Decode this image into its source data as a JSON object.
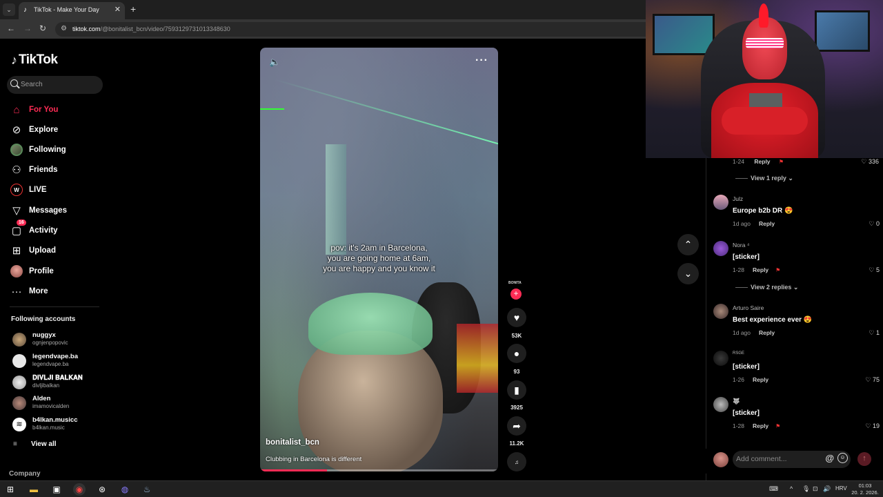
{
  "browser": {
    "tab_title": "TikTok - Make Your Day",
    "url_host": "tiktok.com",
    "url_path": "/@bonitalist_bcn/video/7593129731013348630"
  },
  "sidebar": {
    "logo": "TikTok",
    "search_placeholder": "Search",
    "nav": [
      {
        "label": "For You",
        "icon": "home-icon"
      },
      {
        "label": "Explore",
        "icon": "compass-icon"
      },
      {
        "label": "Following",
        "icon": "following-avatar-icon"
      },
      {
        "label": "Friends",
        "icon": "friends-icon"
      },
      {
        "label": "LIVE",
        "icon": "live-icon"
      },
      {
        "label": "Messages",
        "icon": "messages-icon"
      },
      {
        "label": "Activity",
        "icon": "activity-icon",
        "badge": "16"
      },
      {
        "label": "Upload",
        "icon": "upload-icon"
      },
      {
        "label": "Profile",
        "icon": "profile-icon"
      },
      {
        "label": "More",
        "icon": "more-icon"
      }
    ],
    "following_title": "Following accounts",
    "accounts": [
      {
        "name": "nuggyx",
        "handle": "ognjenpopovic"
      },
      {
        "name": "legendvape.ba",
        "handle": "legendvape.ba"
      },
      {
        "name": "𝐃𝐈𝐕𝐋𝐉𝐈 𝐁𝐀𝐋𝐊𝐀𝐍",
        "handle": "divljibalkan"
      },
      {
        "name": "Alden",
        "handle": "imamovicalden"
      },
      {
        "name": "b4lkan.musicc",
        "handle": "b4lkan.music"
      }
    ],
    "view_all": "View all",
    "company": "Company"
  },
  "video": {
    "caption_lines": [
      "pov: it's 2am in Barcelona,",
      "you are going home at 6am,",
      "you are happy and you know it"
    ],
    "author": "bonitalist_bcn",
    "description": "Clubbing in Barcelona is different",
    "progress": 0.28
  },
  "actions": {
    "author_tag": "BONITA",
    "likes": "53K",
    "comments": "93",
    "saves": "3925",
    "shares": "11.2K"
  },
  "comments": {
    "top_partial": {
      "date": "1-24",
      "reply": "Reply",
      "likes": "336"
    },
    "view_reply_1": "View 1 reply",
    "list": [
      {
        "user": "Julz",
        "text": "Europe b2b DR 😍",
        "date": "1d ago",
        "reply": "Reply",
        "likes": "0"
      },
      {
        "user": "Nora ⁴",
        "text": "[sticker]",
        "date": "1-28",
        "reply": "Reply",
        "likes": "5"
      },
      {
        "user": "Arturo Saire",
        "text": "Best experience ever 😍",
        "date": "1d ago",
        "reply": "Reply",
        "likes": "1"
      },
      {
        "user": "RSGE",
        "text": "[sticker]",
        "date": "1-26",
        "reply": "Reply",
        "likes": "75"
      },
      {
        "user": "🐺",
        "text": "[sticker]",
        "date": "1-28",
        "reply": "Reply",
        "likes": "19"
      }
    ],
    "view_replies_2": "View 2 replies",
    "add_placeholder": "Add comment..."
  },
  "taskbar": {
    "lang": "HRV",
    "time": "01:03",
    "date": "20. 2. 2026."
  },
  "colors": {
    "accent": "#fe2c55"
  }
}
